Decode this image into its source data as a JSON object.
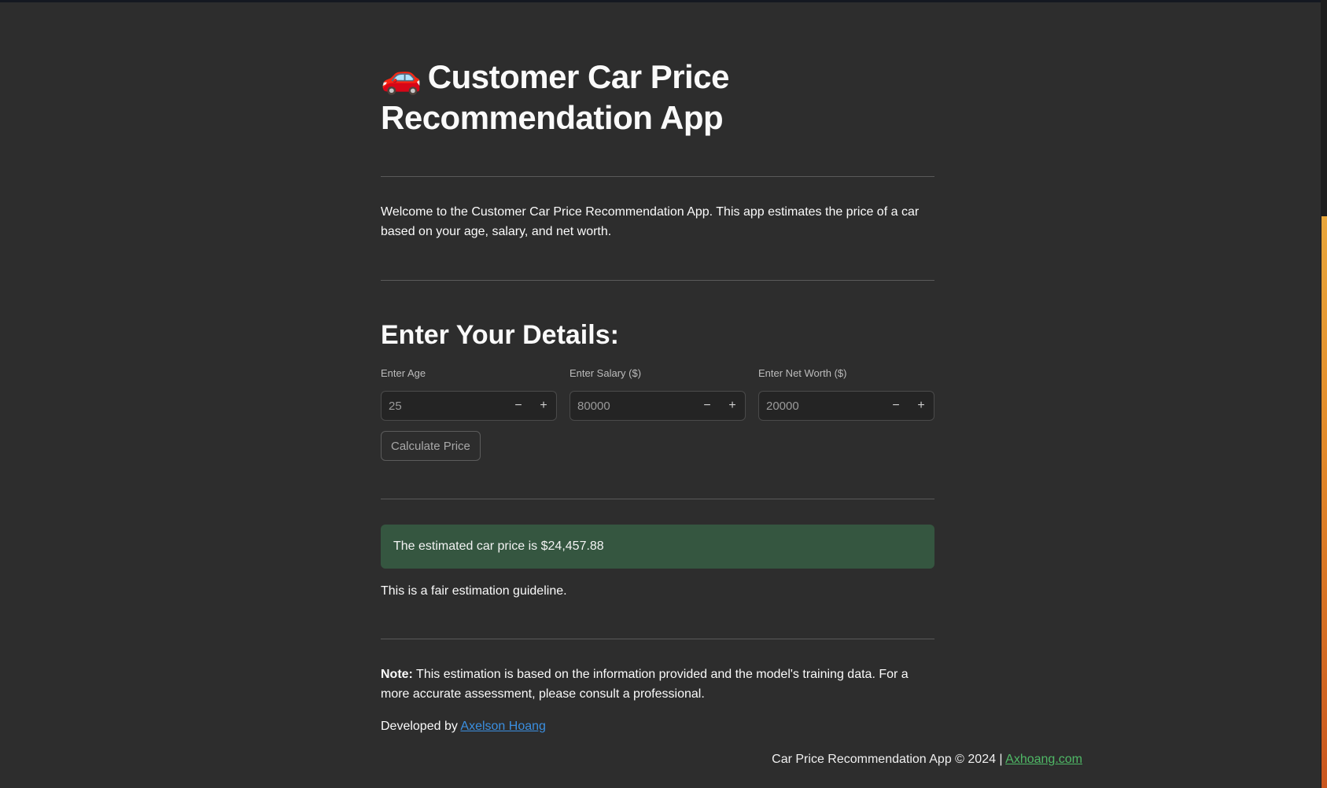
{
  "header": {
    "icon": "🚗",
    "title": "Customer Car Price Recommendation App"
  },
  "intro": {
    "text": "Welcome to the Customer Car Price Recommendation App. This app estimates the price of a car based on your age, salary, and net worth."
  },
  "form": {
    "heading": "Enter Your Details:",
    "fields": [
      {
        "label": "Enter Age",
        "value": "25"
      },
      {
        "label": "Enter Salary ($)",
        "value": "80000"
      },
      {
        "label": "Enter Net Worth ($)",
        "value": "20000"
      }
    ],
    "decrement_symbol": "−",
    "increment_symbol": "+",
    "button_label": "Calculate Price"
  },
  "result": {
    "message": "The estimated car price is $24,457.88",
    "guideline": "This is a fair estimation guideline."
  },
  "note": {
    "label": "Note:",
    "text": " This estimation is based on the information provided and the model's training data. For a more accurate assessment, please consult a professional."
  },
  "credits": {
    "prefix": "Developed by ",
    "author": "Axelson Hoang"
  },
  "footer": {
    "text": "Car Price Recommendation App © 2024 | ",
    "link": "Axhoang.com"
  },
  "colors": {
    "background": "#2d2d2d",
    "success_box": "#355640",
    "link_blue": "#3b8fe0",
    "link_green": "#4fb866"
  }
}
